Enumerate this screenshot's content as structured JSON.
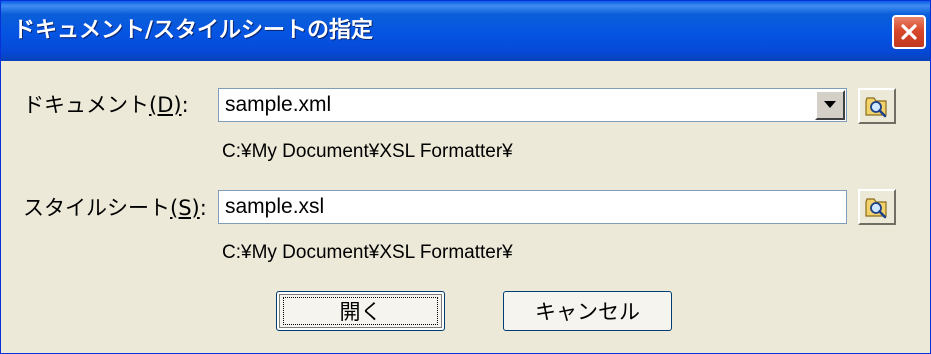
{
  "window": {
    "title": "ドキュメント/スタイルシートの指定"
  },
  "document": {
    "label_text": "ドキュメント",
    "label_key": "(D)",
    "label_colon": ":",
    "value": "sample.xml",
    "path": "C:¥My Document¥XSL Formatter¥"
  },
  "stylesheet": {
    "label_text": "スタイルシート",
    "label_key": "(S)",
    "label_colon": ":",
    "value": "sample.xsl",
    "path": "C:¥My Document¥XSL Formatter¥"
  },
  "buttons": {
    "open_label": "開く",
    "cancel_label": "キャンセル"
  },
  "icons": {
    "close": "close-icon",
    "dropdown": "chevron-down-icon",
    "browse": "folder-search-icon"
  },
  "colors": {
    "titlebar": "#0554e3",
    "dialog_bg": "#ece9d8",
    "close_button": "#d8472b"
  }
}
